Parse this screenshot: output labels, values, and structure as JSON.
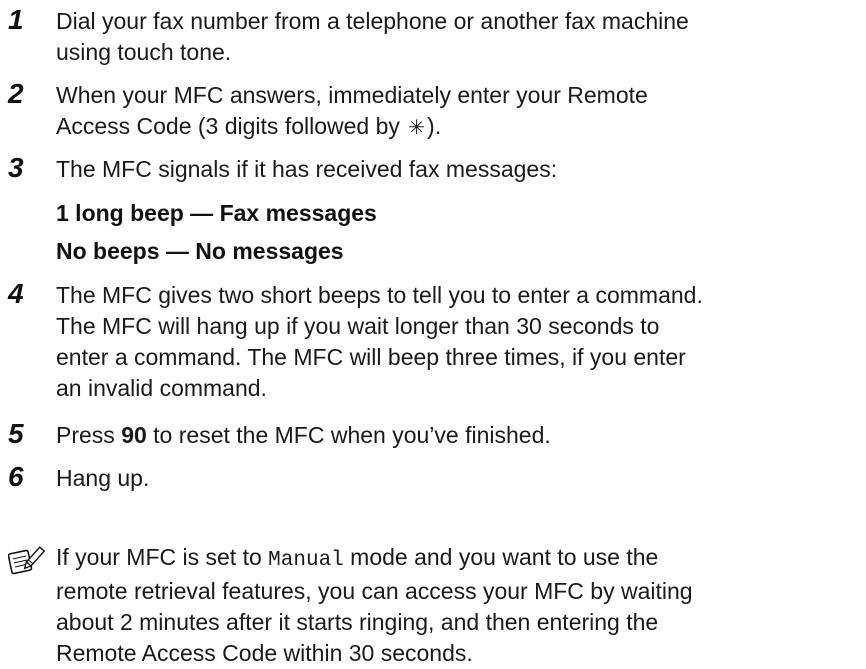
{
  "steps": [
    {
      "number": "1",
      "lines": [
        "Dial your fax number from a telephone or another fax machine",
        "using touch tone."
      ]
    },
    {
      "number": "2",
      "lines": [
        "When your MFC answers, immediately enter your Remote",
        "Access Code (3 digits followed by "
      ],
      "line2_suffix": ").",
      "star_symbol": "✳"
    },
    {
      "number": "3",
      "lines": [
        "The MFC signals if it has received fax messages:"
      ],
      "signals": [
        "1 long beep — Fax messages",
        "No beeps — No messages"
      ]
    },
    {
      "number": "4",
      "lines": [
        "The MFC gives two short beeps to tell you to enter a command.",
        "The MFC will hang up if you wait longer than 30 seconds to",
        "enter a command. The MFC will beep three times, if you enter",
        "an invalid command."
      ]
    },
    {
      "number": "5",
      "prefix": "Press ",
      "bold": "90",
      "suffix": " to reset the MFC when you’ve finished."
    },
    {
      "number": "6",
      "lines": [
        "Hang up."
      ]
    }
  ],
  "note": {
    "icon": "note-pencil-icon",
    "line1_prefix": "If your MFC is set to ",
    "line1_mono": "Manual",
    "line1_suffix": " mode and you want to use the",
    "lines": [
      "remote retrieval features, you can access your MFC by waiting",
      "about 2 minutes after it starts ringing, and then entering the",
      "Remote Access Code within 30 seconds."
    ]
  }
}
